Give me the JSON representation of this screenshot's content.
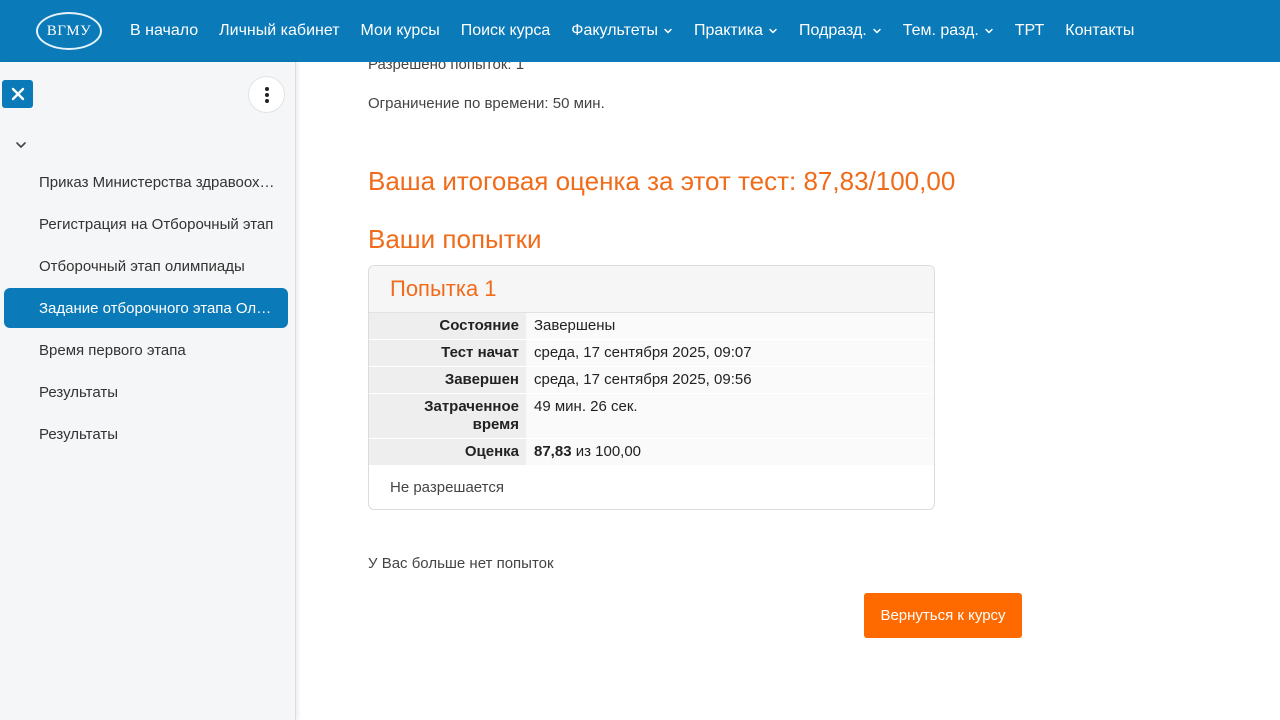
{
  "header": {
    "logo_text": "ВГМУ",
    "nav": [
      {
        "label": "В начало",
        "dropdown": false
      },
      {
        "label": "Личный кабинет",
        "dropdown": false
      },
      {
        "label": "Мои курсы",
        "dropdown": false
      },
      {
        "label": "Поиск курса",
        "dropdown": false
      },
      {
        "label": "Факультеты",
        "dropdown": true
      },
      {
        "label": "Практика",
        "dropdown": true
      },
      {
        "label": "Подразд.",
        "dropdown": true
      },
      {
        "label": "Тем. разд.",
        "dropdown": true
      },
      {
        "label": "ТРТ",
        "dropdown": false
      },
      {
        "label": "Контакты",
        "dropdown": false
      }
    ]
  },
  "sidebar": {
    "items": [
      {
        "label": "Приказ Министерства здравоохранения",
        "active": false
      },
      {
        "label": "Регистрация на Отборочный этап",
        "active": false
      },
      {
        "label": "Отборочный этап олимпиады",
        "active": false
      },
      {
        "label": "Задание отборочного этапа Олимпиады",
        "active": true
      },
      {
        "label": "Время первого этапа",
        "active": false
      },
      {
        "label": "Результаты",
        "active": false
      },
      {
        "label": "Результаты",
        "active": false
      }
    ]
  },
  "main": {
    "attempts_allowed": "Разрешено попыток: 1",
    "time_limit": "Ограничение по времени: 50 мин.",
    "final_grade": "Ваша итоговая оценка за этот тест: 87,83/100,00",
    "attempts_title": "Ваши попытки",
    "attempt": {
      "title": "Попытка 1",
      "rows": [
        {
          "label": "Состояние",
          "value": "Завершены"
        },
        {
          "label": "Тест начат",
          "value": "среда, 17 сентября 2025, 09:07"
        },
        {
          "label": "Завершен",
          "value": "среда, 17 сентября 2025, 09:56"
        },
        {
          "label": "Затраченное время",
          "value": "49 мин. 26 сек."
        }
      ],
      "grade_label": "Оценка",
      "grade_value": "87,83",
      "grade_suffix": " из 100,00",
      "review_note": "Не разрешается"
    },
    "no_more_attempts": "У Вас больше нет попыток",
    "return_button": "Вернуться к курсу"
  },
  "colors": {
    "brand_blue": "#0a7ab8",
    "accent_orange": "#f06b1a",
    "button_orange": "#ff6a00"
  }
}
